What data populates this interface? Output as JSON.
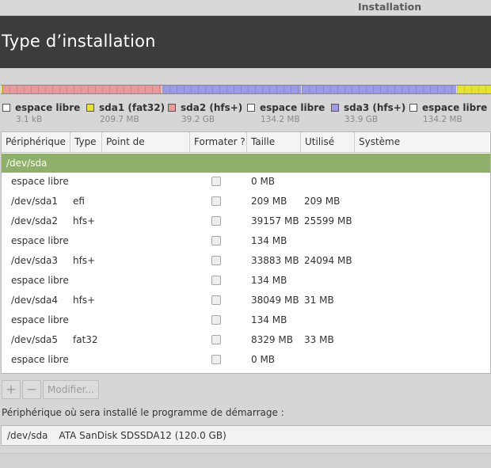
{
  "window": {
    "title": "Installation"
  },
  "header": {
    "title": "Type d’installation"
  },
  "colors": {
    "free": "#ffffff",
    "fat32": "#e6e22e",
    "hfs_sda2": "#e89999",
    "hfs_sda3": "#9a9ae8",
    "group_row": "#8fb06b"
  },
  "partition_bar": [
    {
      "name": "espace libre",
      "fraction": 3e-05,
      "color": "#ffffff"
    },
    {
      "name": "sda1",
      "fraction": 0.0017,
      "color": "#e6e22e"
    },
    {
      "name": "sda2",
      "fraction": 0.326,
      "color": "#e89999"
    },
    {
      "name": "espace libre",
      "fraction": 0.0011,
      "color": "#ffffff"
    },
    {
      "name": "sda3",
      "fraction": 0.282,
      "color": "#9a9ae8"
    },
    {
      "name": "espace libre",
      "fraction": 0.0011,
      "color": "#ffffff"
    },
    {
      "name": "sda4",
      "fraction": 0.317,
      "color": "#9a9ae8"
    },
    {
      "name": "espace libre",
      "fraction": 0.0011,
      "color": "#ffffff"
    },
    {
      "name": "sda5",
      "fraction": 0.069,
      "color": "#e6e22e"
    }
  ],
  "legend": [
    {
      "name": "espace libre",
      "size": "3.1 kB",
      "color": "#ffffff"
    },
    {
      "name": "sda1 (fat32)",
      "size": "209.7 MB",
      "color": "#e6e22e"
    },
    {
      "name": "sda2 (hfs+)",
      "size": "39.2 GB",
      "color": "#e89999"
    },
    {
      "name": "espace libre",
      "size": "134.2 MB",
      "color": "#ffffff"
    },
    {
      "name": "sda3 (hfs+)",
      "size": "33.9 GB",
      "color": "#9a9ae8"
    },
    {
      "name": "espace libre",
      "size": "134.2 MB",
      "color": "#ffffff"
    }
  ],
  "table": {
    "columns": [
      "Périphérique",
      "Type",
      "Point de montage",
      "Formater ?",
      "Taille",
      "Utilisé",
      "Système"
    ],
    "group": "/dev/sda",
    "rows": [
      {
        "device": "espace libre",
        "type": "",
        "mount": "",
        "format": false,
        "size": "0 MB",
        "used": "",
        "system": ""
      },
      {
        "device": "/dev/sda1",
        "type": "efi",
        "mount": "",
        "format": false,
        "size": "209 MB",
        "used": "209 MB",
        "system": ""
      },
      {
        "device": "/dev/sda2",
        "type": "hfs+",
        "mount": "",
        "format": false,
        "size": "39157 MB",
        "used": "25599 MB",
        "system": ""
      },
      {
        "device": "espace libre",
        "type": "",
        "mount": "",
        "format": false,
        "size": "134 MB",
        "used": "",
        "system": ""
      },
      {
        "device": "/dev/sda3",
        "type": "hfs+",
        "mount": "",
        "format": false,
        "size": "33883 MB",
        "used": "24094 MB",
        "system": ""
      },
      {
        "device": "espace libre",
        "type": "",
        "mount": "",
        "format": false,
        "size": "134 MB",
        "used": "",
        "system": ""
      },
      {
        "device": "/dev/sda4",
        "type": "hfs+",
        "mount": "",
        "format": false,
        "size": "38049 MB",
        "used": "31 MB",
        "system": ""
      },
      {
        "device": "espace libre",
        "type": "",
        "mount": "",
        "format": false,
        "size": "134 MB",
        "used": "",
        "system": ""
      },
      {
        "device": "/dev/sda5",
        "type": "fat32",
        "mount": "",
        "format": false,
        "size": "8329 MB",
        "used": "33 MB",
        "system": ""
      },
      {
        "device": "espace libre",
        "type": "",
        "mount": "",
        "format": false,
        "size": "0 MB",
        "used": "",
        "system": ""
      }
    ]
  },
  "toolbar": {
    "add_label": "+",
    "remove_label": "−",
    "modify_label": "Modifier..."
  },
  "bootloader": {
    "label": "Périphérique où sera installé le programme de démarrage :",
    "device": "/dev/sda",
    "model": "ATA SanDisk SDSSDA12 (120.0 GB)"
  }
}
